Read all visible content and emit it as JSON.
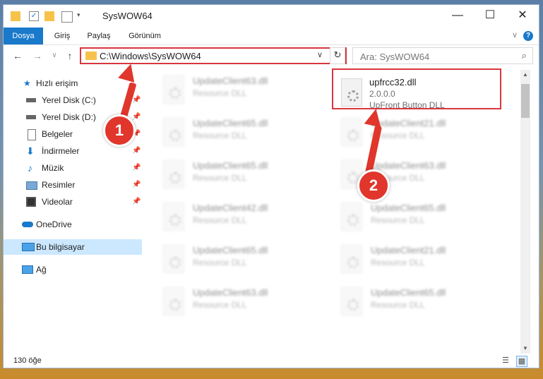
{
  "window": {
    "title": "SysWOW64",
    "minimize_glyph": "—",
    "maximize_glyph": "☐",
    "close_glyph": "✕"
  },
  "ribbon": {
    "tabs": [
      "Dosya",
      "Giriş",
      "Paylaş",
      "Görünüm"
    ],
    "help_glyph": "?",
    "expand_glyph": "∨"
  },
  "nav": {
    "back_glyph": "←",
    "forward_glyph": "→",
    "recent_glyph": "∨",
    "up_glyph": "↑",
    "address_path": "C:\\Windows\\SysWOW64",
    "address_dropdown_glyph": "∨",
    "refresh_glyph": "↻",
    "search_placeholder": "Ara: SysWOW64",
    "search_icon_glyph": "⌕"
  },
  "sidebar": {
    "items": [
      {
        "label": "Hızlı erişim",
        "icon": "star-icon"
      },
      {
        "label": "Yerel Disk (C:)",
        "icon": "drive-icon",
        "pinned": true
      },
      {
        "label": "Yerel Disk (D:)",
        "icon": "drive-icon",
        "pinned": true
      },
      {
        "label": "Belgeler",
        "icon": "document-icon",
        "pinned": true
      },
      {
        "label": "İndirmeler",
        "icon": "download-icon",
        "pinned": true
      },
      {
        "label": "Müzik",
        "icon": "music-icon",
        "pinned": true
      },
      {
        "label": "Resimler",
        "icon": "pictures-icon",
        "pinned": true
      },
      {
        "label": "Videolar",
        "icon": "videos-icon",
        "pinned": true
      },
      {
        "label": "OneDrive",
        "icon": "cloud-icon"
      },
      {
        "label": "Bu bilgisayar",
        "icon": "computer-icon",
        "selected": true
      },
      {
        "label": "Ağ",
        "icon": "network-icon"
      }
    ],
    "pin_glyph": "📌"
  },
  "files": {
    "left": [
      {
        "name": "UpdateClient63.dll",
        "desc": "Resource DLL"
      },
      {
        "name": "UpdateClient65.dll",
        "desc": "Resource DLL"
      },
      {
        "name": "UpdateClient65.dll",
        "desc": "Resource DLL"
      },
      {
        "name": "UpdateClient42.dll",
        "desc": "Resource DLL"
      },
      {
        "name": "UpdateClient65.dll",
        "desc": "Resource DLL"
      },
      {
        "name": "UpdateClient63.dll",
        "desc": "Resource DLL"
      }
    ],
    "right": [
      {
        "name": "UpdateClient21.dll",
        "desc": "Resource DLL"
      },
      {
        "name": "UpdateClient63.dll",
        "desc": "Resource DLL"
      },
      {
        "name": "UpdateClient65.dll",
        "desc": "Resource DLL"
      },
      {
        "name": "UpdateClient21.dll",
        "desc": "Resource DLL"
      },
      {
        "name": "UpdateClient65.dll",
        "desc": "Resource DLL"
      }
    ],
    "highlighted": {
      "name": "upfrcc32.dll",
      "version": "2.0.0.0",
      "desc": "UpFront Button DLL"
    }
  },
  "status": {
    "count_text": "130 öğe"
  },
  "callouts": [
    {
      "number": "1"
    },
    {
      "number": "2"
    }
  ],
  "colors": {
    "accent": "#1979ca",
    "highlight_red": "#d9363e",
    "callout_red": "#e0362c",
    "selected_bg": "#cce8ff"
  }
}
